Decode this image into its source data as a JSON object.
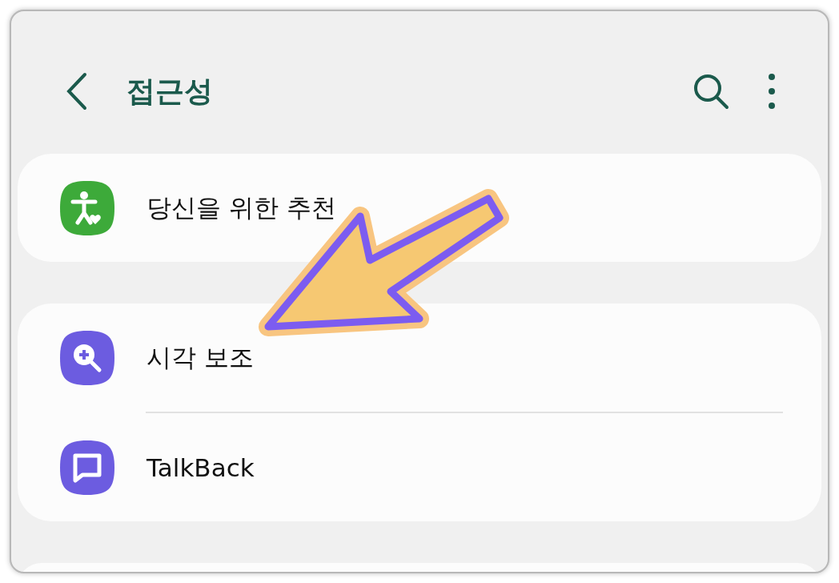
{
  "header": {
    "title": "접근성"
  },
  "sections": [
    {
      "items": [
        {
          "label": "당신을 위한 추천",
          "kind": "accessibility",
          "color": "#3daa3a"
        }
      ]
    },
    {
      "items": [
        {
          "label": "시각 보조",
          "kind": "magnifier",
          "color": "#6c5ce0"
        },
        {
          "label": "TalkBack",
          "kind": "chat",
          "color": "#6c5ce0"
        }
      ]
    },
    {
      "kind": "partial"
    }
  ]
}
